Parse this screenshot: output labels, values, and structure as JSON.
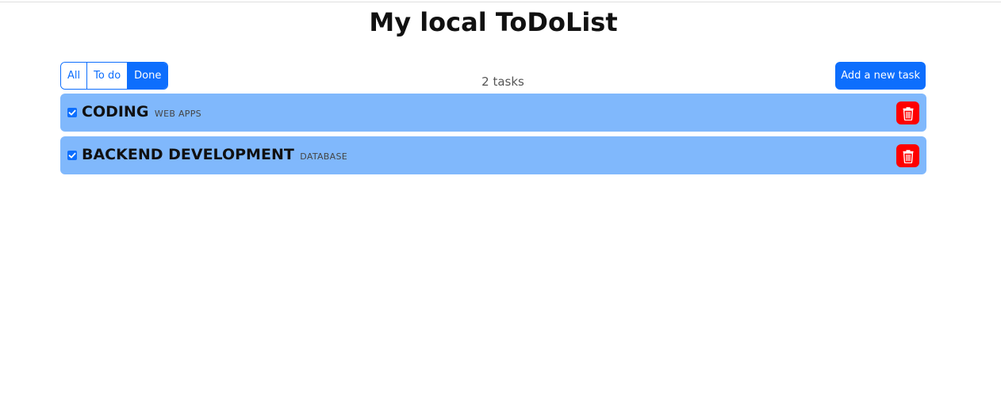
{
  "app": {
    "title": "My local ToDoList"
  },
  "toolbar": {
    "filters": [
      {
        "label": "All",
        "active": false
      },
      {
        "label": "To do",
        "active": false
      },
      {
        "label": "Done",
        "active": true
      }
    ],
    "task_count": "2 tasks",
    "add_label": "Add a new task"
  },
  "tasks": [
    {
      "title": "CODING",
      "tag": "WEB APPS",
      "checked": true
    },
    {
      "title": "BACKEND DEVELOPMENT",
      "tag": "DATABASE",
      "checked": true
    }
  ],
  "colors": {
    "accent": "#0d6efd",
    "task_background": "#80b8fc",
    "delete": "#ff0000"
  },
  "icons": {
    "checkbox": "checkbox-checked-icon",
    "delete": "trash-icon"
  }
}
